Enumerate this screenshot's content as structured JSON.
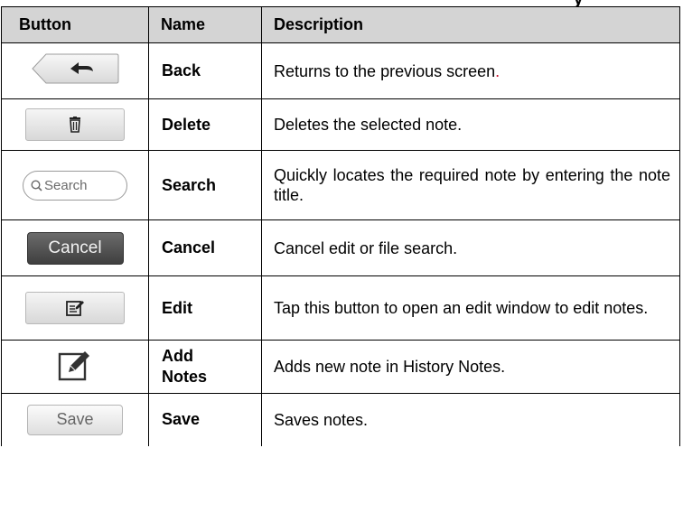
{
  "page_heading_fragment": "y",
  "table": {
    "headers": [
      "Button",
      "Name",
      "Description"
    ],
    "rows": [
      {
        "icon": "back-arrow-icon",
        "name": "Back",
        "description": "Returns to the previous screen",
        "trailing": "."
      },
      {
        "icon": "trash-icon",
        "name": "Delete",
        "description": "Deletes the selected note.",
        "trailing": ""
      },
      {
        "icon": "search-icon",
        "button_text": "Search",
        "name": "Search",
        "description": "Quickly locates the required note by entering the note title.",
        "trailing": ""
      },
      {
        "icon": "",
        "button_text": "Cancel",
        "name": "Cancel",
        "description": "Cancel edit or file search.",
        "trailing": ""
      },
      {
        "icon": "edit-icon",
        "name": "Edit",
        "description": "Tap this button to open an edit window to edit notes.",
        "trailing": ""
      },
      {
        "icon": "add-note-icon",
        "name": "Add Notes",
        "name_lines": [
          "Add",
          "Notes"
        ],
        "description": "Adds new note in History Notes.",
        "trailing": ""
      },
      {
        "icon": "",
        "button_text": "Save",
        "name": "Save",
        "description": "Saves notes.",
        "trailing": ""
      }
    ]
  },
  "colors": {
    "header_bg": "#d4d4d4",
    "accent_red": "#c8102e",
    "cancel_bg": "#4a4a4a"
  }
}
